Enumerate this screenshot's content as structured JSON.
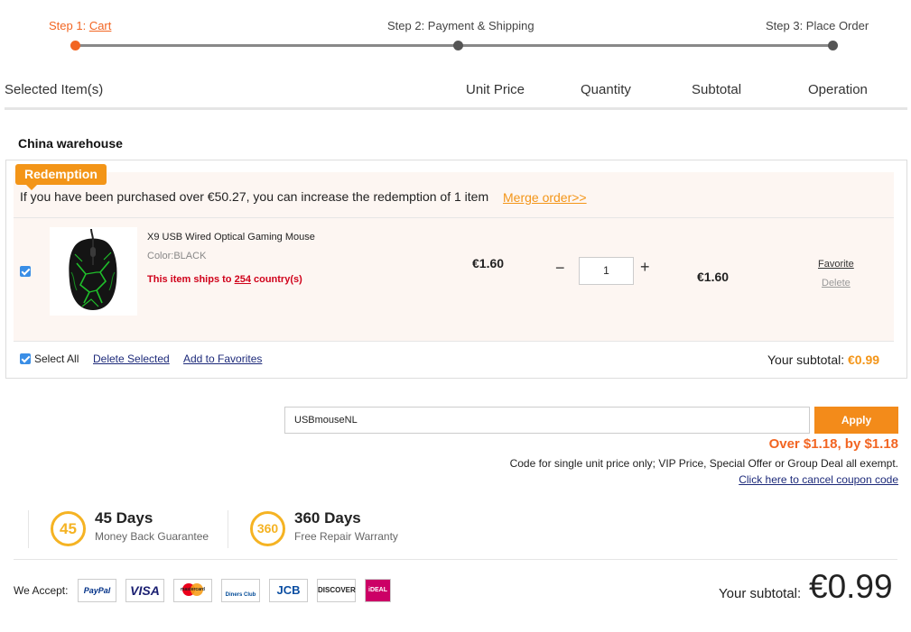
{
  "steps": {
    "step1_prefix": "Step 1: ",
    "step1_link": "Cart",
    "step2": "Step 2: Payment & Shipping",
    "step3": "Step 3: Place Order"
  },
  "header": {
    "selected": "Selected Item(s)",
    "unit_price": "Unit Price",
    "quantity": "Quantity",
    "subtotal": "Subtotal",
    "operation": "Operation"
  },
  "warehouse": "China warehouse",
  "promo": {
    "tag": "Redemption",
    "text": "If you have been purchased over €50.27, you can increase the redemption of 1 item",
    "merge": "Merge order>>"
  },
  "item": {
    "name": "X9 USB Wired Optical Gaming Mouse",
    "color": "Color:BLACK",
    "ships_prefix": "This item ships to ",
    "ships_count": "254",
    "ships_suffix": " country(s)",
    "unit_price": "€1.60",
    "qty_minus": "−",
    "quantity": "1",
    "qty_plus": "+",
    "subtotal": "€1.60",
    "favorite": "Favorite",
    "delete": "Delete",
    "checked": true
  },
  "box_footer": {
    "select_all": "Select All",
    "delete_selected": "Delete Selected",
    "add_favorites": "Add to Favorites",
    "subtotal_label": "Your subtotal: ",
    "subtotal_value": "€0.99"
  },
  "coupon": {
    "code": "USBmouseNL",
    "apply": "Apply",
    "message": "Over $1.18, by $1.18",
    "note": "Code for single unit price only; VIP Price, Special Offer or Group Deal all exempt.",
    "cancel": "Click here to cancel coupon code"
  },
  "guarantees": [
    {
      "badge": "45",
      "title": "45 Days",
      "subtitle": "Money Back Guarantee"
    },
    {
      "badge": "360",
      "title": "360 Days",
      "subtitle": "Free Repair Warranty"
    }
  ],
  "payments": {
    "label": "We Accept:",
    "methods": [
      "PayPal",
      "VISA",
      "mastercard",
      "Diners Club",
      "JCB",
      "DISCOVER",
      "iDEAL"
    ]
  },
  "final": {
    "label": "Your subtotal:",
    "value": "€0.99"
  },
  "colors": {
    "accent": "#f26522",
    "orange": "#f39518",
    "link": "#1d2a7a",
    "checkbox": "#3a8ee6",
    "badge": "#f5b323"
  }
}
